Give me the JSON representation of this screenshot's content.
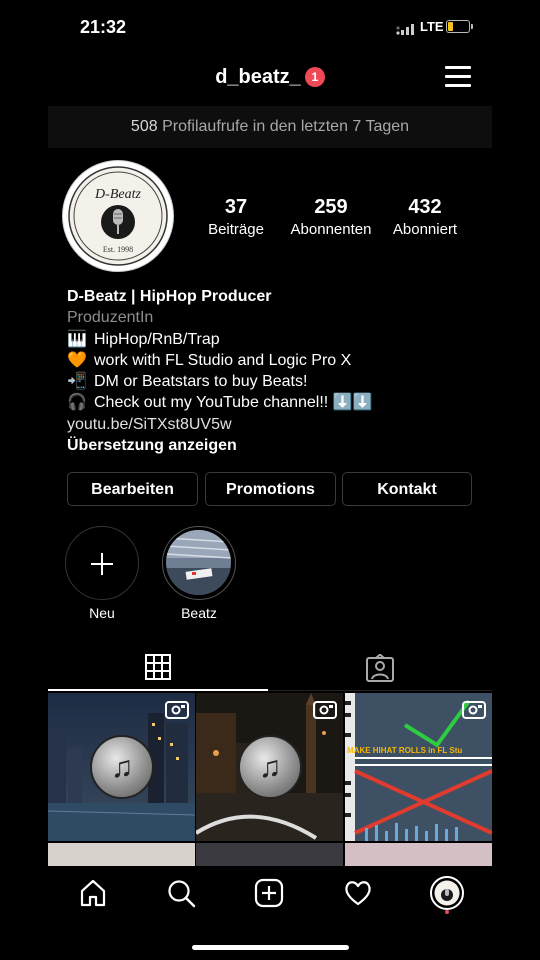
{
  "status_bar": {
    "time": "21:32",
    "network": "LTE"
  },
  "header": {
    "username": "d_beatz_",
    "notification_count": "1",
    "menu_icon": "hamburger-menu-icon"
  },
  "insights": {
    "views": "508",
    "text": "Profilaufrufe in den letzten 7 Tagen"
  },
  "profile": {
    "avatar_text": "D-Beatz",
    "avatar_est": "Est. 1998",
    "stats": [
      {
        "value": "37",
        "label": "Beiträge"
      },
      {
        "value": "259",
        "label": "Abonnenten"
      },
      {
        "value": "432",
        "label": "Abonniert"
      }
    ],
    "name": "D-Beatz | HipHop Producer",
    "category": "ProduzentIn",
    "bio_lines": [
      {
        "emoji": "🎹",
        "text": "HipHop/RnB/Trap"
      },
      {
        "emoji": "🧡",
        "text": "work with FL Studio and Logic Pro X"
      },
      {
        "emoji": "📲",
        "text": "DM or Beatstars to buy Beats!"
      },
      {
        "emoji": "🎧",
        "text": "Check out my YouTube channel!! ⬇️⬇️"
      }
    ],
    "link": "youtu.be/SiTXst8UV5w",
    "translate": "Übersetzung anzeigen"
  },
  "buttons": {
    "edit": "Bearbeiten",
    "promotions": "Promotions",
    "contact": "Kontakt"
  },
  "highlights": [
    {
      "label": "Neu"
    },
    {
      "label": "Beatz"
    }
  ],
  "tabs": {
    "grid_icon": "grid-icon",
    "tagged_icon": "tagged-person-icon"
  },
  "posts": [
    {
      "type": "video",
      "overlay_text": ""
    },
    {
      "type": "video",
      "overlay_text": ""
    },
    {
      "type": "video",
      "overlay_text": "MAKE HIHAT ROLLS in FL Stu"
    }
  ],
  "bottom_nav": [
    "home-icon",
    "search-icon",
    "new-post-icon",
    "activity-heart-icon",
    "profile-icon"
  ]
}
